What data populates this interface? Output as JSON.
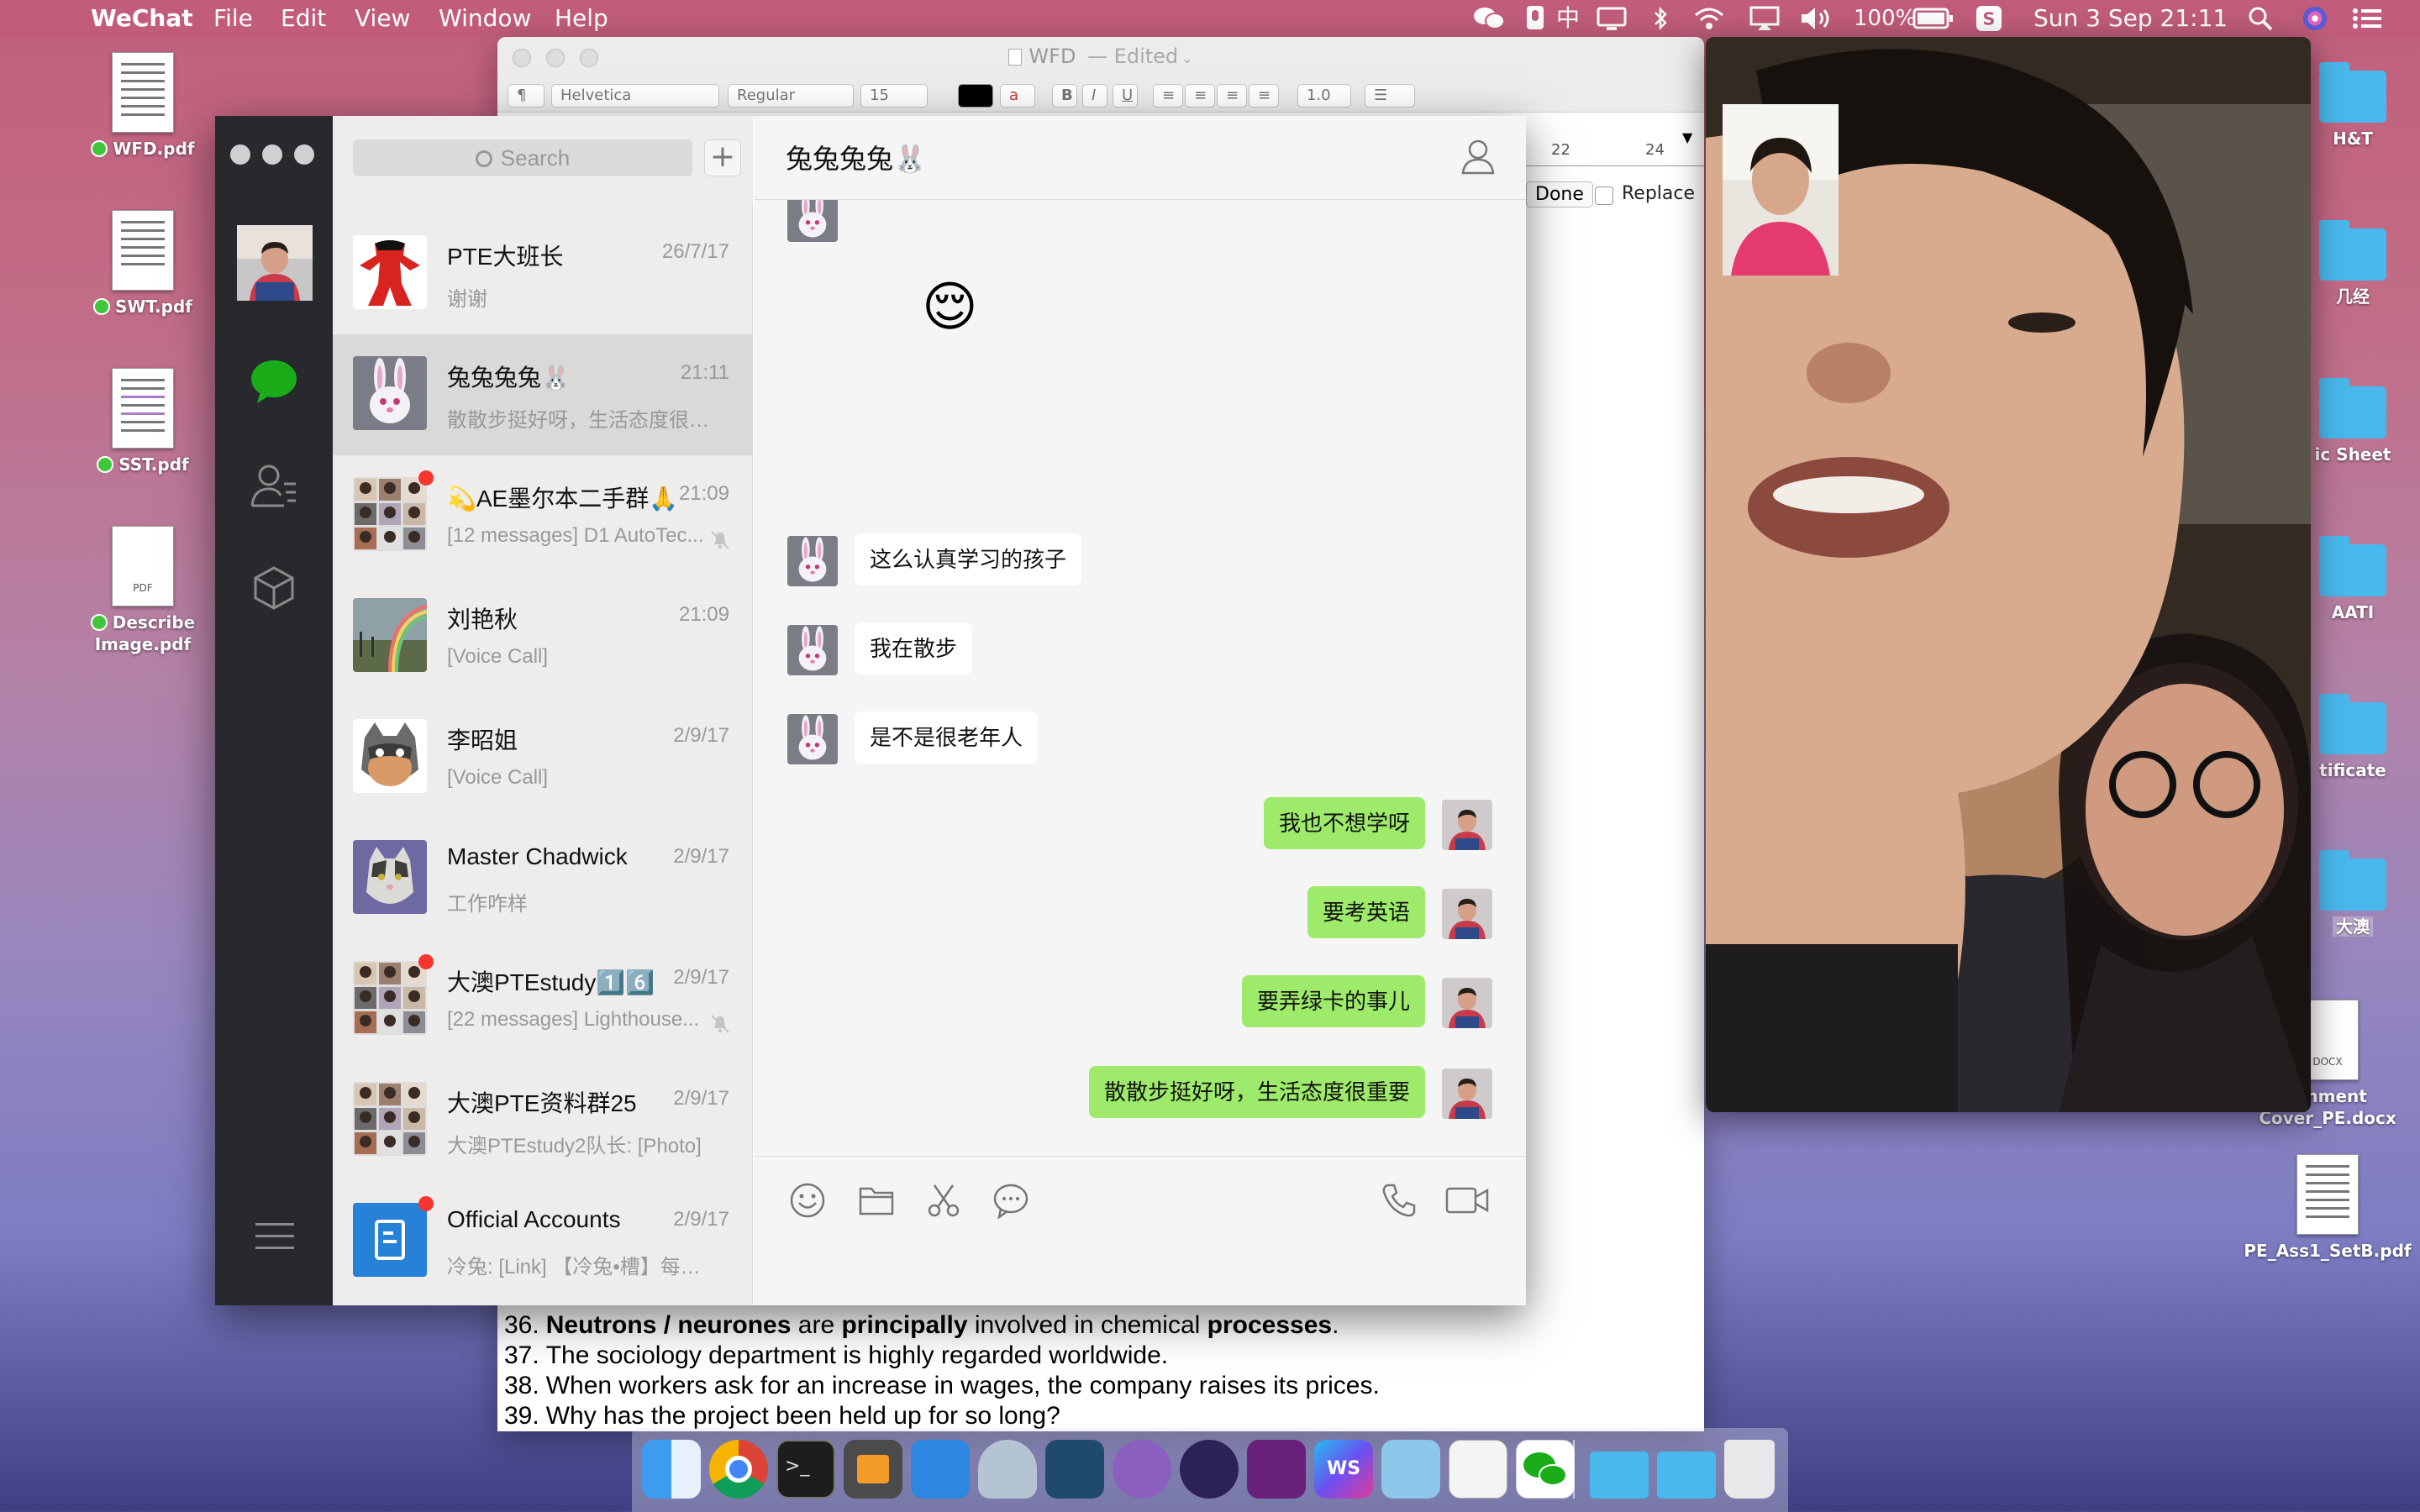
{
  "menubar": {
    "app": "WeChat",
    "menus": [
      "File",
      "Edit",
      "View",
      "Window",
      "Help"
    ],
    "input_method": "中",
    "battery": "100%",
    "datetime": "Sun 3 Sep  21:11"
  },
  "desktop_left": [
    {
      "label": "WFD.pdf"
    },
    {
      "label": "SWT.pdf"
    },
    {
      "label": "SST.pdf"
    },
    {
      "label": "Describe Image.pdf",
      "doc_tag": "PDF"
    }
  ],
  "desktop_right": [
    {
      "label": "H&T"
    },
    {
      "label": "几经"
    },
    {
      "label": "ic Sheet"
    },
    {
      "label": "AATI"
    },
    {
      "label": "tificate"
    },
    {
      "label": "大澳"
    },
    {
      "label": "ignment Cover_PE.docx",
      "doc_tag": "DOCX"
    },
    {
      "label": "PE_Ass1_SetB.pdf"
    }
  ],
  "textedit": {
    "title": "WFD",
    "edited": "— Edited",
    "font": "Helvetica",
    "style": "Regular",
    "size": "15",
    "spacing": "1.0",
    "ruler": [
      "22",
      "24"
    ],
    "done": "Done",
    "replace": "Replace",
    "lines": [
      {
        "num": "36.",
        "parts": [
          {
            "t": "Neutrons / neurones",
            "b": true
          },
          {
            "t": " are "
          },
          {
            "t": "principally",
            "b": true
          },
          {
            "t": " involved in chemical "
          },
          {
            "t": "processes",
            "b": true
          },
          {
            "t": "."
          }
        ]
      },
      {
        "num": "37.",
        "parts": [
          {
            "t": "The sociology department is highly regarded worldwide."
          }
        ]
      },
      {
        "num": "38.",
        "parts": [
          {
            "t": "When workers ask for an increase in wages, the company raises its prices."
          }
        ]
      },
      {
        "num": "39.",
        "parts": [
          {
            "t": "Why has the project been held up for so long?"
          }
        ]
      }
    ]
  },
  "wechat": {
    "search_placeholder": "Search",
    "chat_title": "兔兔兔兔🐰",
    "chats": [
      {
        "name": "PTE大班长",
        "time": "26/7/17",
        "preview": "谢谢",
        "avatar": "red-figure"
      },
      {
        "name": "兔兔兔兔🐰",
        "time": "21:11",
        "preview": "散散步挺好呀，生活态度很重要",
        "avatar": "bunny",
        "selected": true
      },
      {
        "name": "💫AE墨尔本二手群🙏",
        "time": "21:09",
        "preview": "[12 messages] D1 AutoTec...",
        "avatar": "group",
        "unread": true,
        "muted": true
      },
      {
        "name": "刘艳秋",
        "time": "21:09",
        "preview": "[Voice Call]",
        "avatar": "rainbow"
      },
      {
        "name": "李昭姐",
        "time": "2/9/17",
        "preview": "[Voice Call]",
        "avatar": "cat-mask"
      },
      {
        "name": "Master Chadwick",
        "time": "2/9/17",
        "preview": "工作咋样",
        "avatar": "cat"
      },
      {
        "name": "大澳PTEstudy1️⃣6️⃣",
        "time": "2/9/17",
        "preview": "[22 messages] Lighthouse...",
        "avatar": "group",
        "unread": true,
        "muted": true
      },
      {
        "name": "大澳PTE资料群25",
        "time": "2/9/17",
        "preview": "大澳PTEstudy2队长: [Photo]",
        "avatar": "group"
      },
      {
        "name": "Official Accounts",
        "time": "2/9/17",
        "preview": "冷兔: [Link] 【冷兔•槽】每日一...",
        "avatar": "official",
        "unread": true
      }
    ],
    "messages": [
      {
        "dir": "in",
        "emoji": "😌"
      },
      {
        "dir": "in",
        "text": "这么认真学习的孩子"
      },
      {
        "dir": "in",
        "text": "我在散步"
      },
      {
        "dir": "in",
        "text": "是不是很老年人"
      },
      {
        "dir": "out",
        "text": "我也不想学呀"
      },
      {
        "dir": "out",
        "text": "要考英语"
      },
      {
        "dir": "out",
        "text": "要弄绿卡的事儿"
      },
      {
        "dir": "out",
        "text": "散散步挺好呀，生活态度很重要"
      }
    ]
  },
  "colors": {
    "accent_green": "#1aad19",
    "bubble_out": "#9eea6a",
    "sidebar": "#28292d",
    "unread": "#f43530"
  }
}
